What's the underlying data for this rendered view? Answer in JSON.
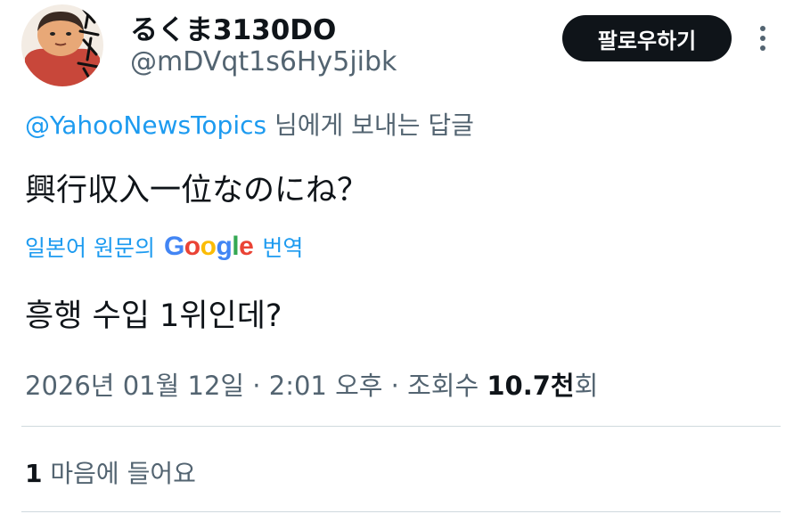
{
  "user": {
    "display_name": "るくま3130DO",
    "handle": "@mDVqt1s6Hy5jibk",
    "avatar_icon": "avatar-image"
  },
  "follow_button_label": "팔로우하기",
  "more_icon": "more-vertical-icon",
  "reply": {
    "mention": "@YahooNewsTopics",
    "suffix": " 님에게 보내는 답글"
  },
  "tweet_text": "興行収入一位なのにね？",
  "translation": {
    "prefix": "일본어 원문의",
    "brand": "Google",
    "suffix": "번역",
    "brand_colors": [
      "#4285F4",
      "#EA4335",
      "#FBBC05",
      "#4285F4",
      "#34A853",
      "#EA4335"
    ]
  },
  "translated_text": "흥행 수입 1위인데?",
  "meta": {
    "date": "2026년 01월 12일",
    "separator": " · ",
    "time": "2:01 오후",
    "views_label": "조회수",
    "views_count": "10.7천",
    "views_suffix": "회"
  },
  "likes": {
    "count": "1",
    "label": " 마음에 들어요"
  },
  "colors": {
    "accent": "#1d9bf0",
    "text": "#0f1419",
    "secondary": "#536471",
    "divider": "#cfd9de"
  }
}
